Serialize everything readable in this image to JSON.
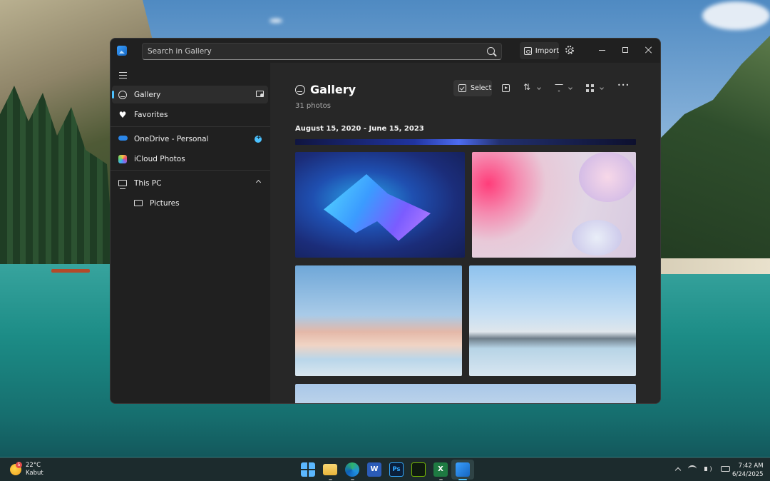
{
  "window": {
    "search": {
      "placeholder": "Search in Gallery"
    },
    "import_label": "Import"
  },
  "sidebar": {
    "items": [
      {
        "label": "Gallery"
      },
      {
        "label": "Favorites"
      },
      {
        "label": "OneDrive - Personal"
      },
      {
        "label": "iCloud Photos"
      },
      {
        "label": "This PC"
      },
      {
        "label": "Pictures"
      }
    ]
  },
  "main": {
    "title": "Gallery",
    "count": "31 photos",
    "select_label": "Select",
    "date_range": "August 15, 2020 - June 15, 2023"
  },
  "taskbar": {
    "weather": {
      "badge": "5",
      "temp": "22°C",
      "condition": "Kabut"
    },
    "apps": [
      "start-icon",
      "file-explorer-icon",
      "edge-icon",
      "word-icon",
      "photoshop-icon",
      "nvidia-icon",
      "excel-icon",
      "photos-icon"
    ],
    "clock": {
      "time": "7:42 AM",
      "date": "6/24/2025"
    }
  },
  "colors": {
    "accent": "#4cc2ff",
    "window_bg": "#202020",
    "content_bg": "#272727"
  }
}
